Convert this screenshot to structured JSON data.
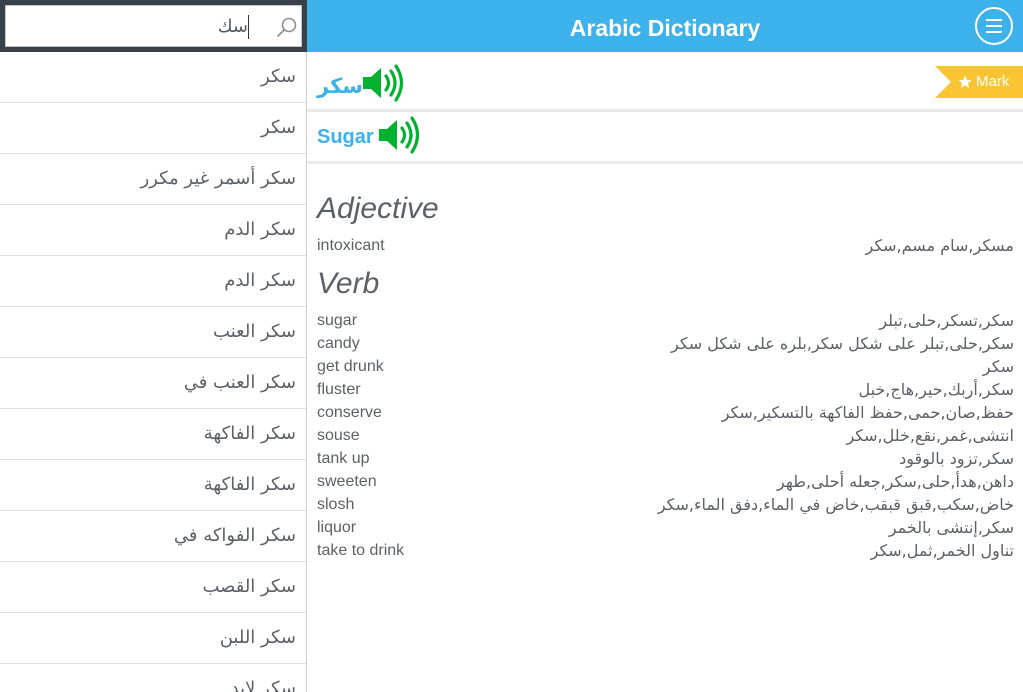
{
  "app": {
    "title": "Arabic Dictionary"
  },
  "search": {
    "value": "سك",
    "icon": "search-icon"
  },
  "menu": {
    "icon": "hamburger-menu-icon"
  },
  "word_list": [
    "سكر",
    "سكر",
    "سكر أسمر غير مكرر",
    "سكر الدم",
    "سكر الدم",
    "سكر العنب",
    "سكر العنب في",
    "سكر الفاكهة",
    "سكر الفاكهة",
    "سكر الفواكه في",
    "سكر القصب",
    "سكر اللبن",
    "سكر لايد"
  ],
  "entry": {
    "arabic_word": "سكر",
    "english_word": "Sugar",
    "speaker_icon": "speaker-icon",
    "mark_label": "Mark",
    "mark_icon": "star-icon"
  },
  "sections": [
    {
      "heading": "Adjective",
      "definitions": [
        {
          "en": "intoxicant",
          "ar": "مسكر,سام مسم,سكر"
        }
      ]
    },
    {
      "heading": "Verb",
      "definitions": [
        {
          "en": "sugar",
          "ar": "سكر,تسكر,حلى,تبلر"
        },
        {
          "en": "candy",
          "ar": "سكر,حلى,تبلر على شكل سكر,بلره على شكل سكر"
        },
        {
          "en": "get drunk",
          "ar": "سكر"
        },
        {
          "en": "fluster",
          "ar": "سكر,أربك,حير,هاج,خبل"
        },
        {
          "en": "conserve",
          "ar": "حفظ,صان,حمى,حفظ الفاكهة بالتسكير,سكر"
        },
        {
          "en": "souse",
          "ar": "انتشى,غمر,نقع,خلل,سكر"
        },
        {
          "en": "tank up",
          "ar": "سكر,تزود بالوقود"
        },
        {
          "en": "sweeten",
          "ar": "داهن,هدأ,حلى,سكر,جعله أحلى,طهر"
        },
        {
          "en": "slosh",
          "ar": "خاض,سكب,قبق قبقب,خاض في الماء,دفق الماء,سكر"
        },
        {
          "en": "liquor",
          "ar": "سكر,إنتشى بالخمر"
        },
        {
          "en": "take to drink",
          "ar": "تناول الخمر,ثمل,سكر"
        }
      ]
    }
  ],
  "colors": {
    "accent": "#3db1e9",
    "mark": "#f8c431",
    "speaker": "#00b22d",
    "search_bg": "#3a4047"
  }
}
